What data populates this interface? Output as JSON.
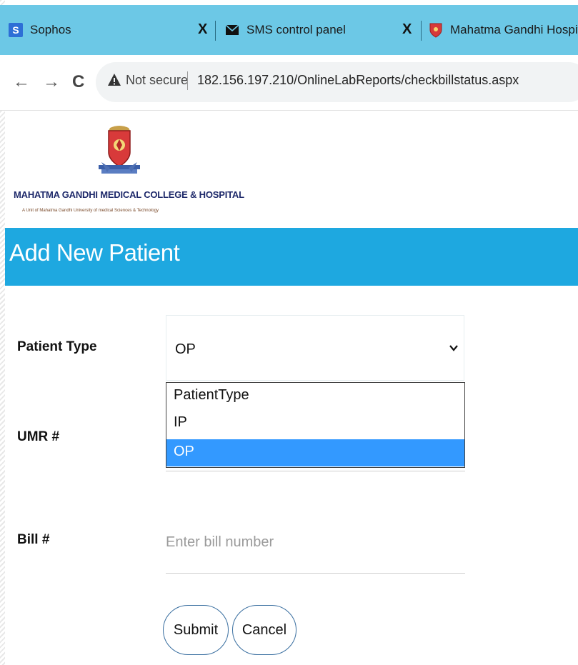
{
  "browser": {
    "tabs": [
      {
        "title": "Sophos",
        "favicon": "S",
        "close": "X"
      },
      {
        "title": "SMS control panel",
        "favicon": "mail-icon",
        "close": "X"
      },
      {
        "title": "Mahatma Gandhi Hospital",
        "favicon": "hospital-crest-icon"
      }
    ],
    "nav": {
      "back": "←",
      "forward": "→",
      "reload": "C"
    },
    "security_label": "Not secure",
    "url": "182.156.197.210/OnlineLabReports/checkbillstatus.aspx",
    "accent_color": "#6cc8e6"
  },
  "logo": {
    "title": "MAHATMA GANDHI MEDICAL COLLEGE & HOSPITAL",
    "subtitle": "A Unit of Mahatma Gandhi University of medical Sciences & Technology"
  },
  "page": {
    "header": "Add New Patient",
    "header_color": "#1ea8e0"
  },
  "form": {
    "patient_type": {
      "label": "Patient Type",
      "value": "OP",
      "options": [
        "PatientType",
        "IP",
        "OP"
      ],
      "selected_option": "OP"
    },
    "umr": {
      "label": "UMR #"
    },
    "bill": {
      "label": "Bill #",
      "placeholder": "Enter bill number"
    },
    "submit_label": "Submit",
    "cancel_label": "Cancel"
  }
}
